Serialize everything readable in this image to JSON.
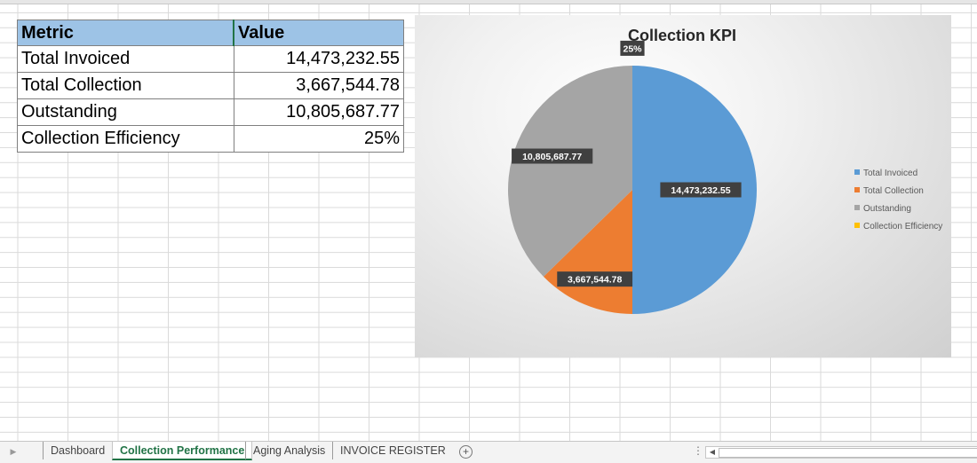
{
  "table": {
    "headers": [
      "Metric",
      "Value"
    ],
    "rows": [
      {
        "metric": "Total Invoiced",
        "value": "14,473,232.55"
      },
      {
        "metric": "Total Collection",
        "value": "3,667,544.78"
      },
      {
        "metric": "Outstanding",
        "value": "10,805,687.77"
      },
      {
        "metric": "Collection Efficiency",
        "value": "25%"
      }
    ]
  },
  "chart_data": {
    "type": "pie",
    "title": "Collection KPI",
    "categories": [
      "Total Invoiced",
      "Total Collection",
      "Outstanding",
      "Collection Efficiency"
    ],
    "values": [
      14473232.55,
      3667544.78,
      10805687.77,
      0.25
    ],
    "data_labels": [
      "14,473,232.55",
      "3,667,544.78",
      "10,805,687.77",
      "25%"
    ],
    "colors": [
      "#5b9bd5",
      "#ed7d31",
      "#a5a5a5",
      "#ffc000"
    ],
    "legend": "right"
  },
  "sheet_tabs": [
    {
      "label": "Dashboard",
      "active": false
    },
    {
      "label": "Collection Performance",
      "active": true
    },
    {
      "label": "Aging Analysis",
      "active": false
    },
    {
      "label": "INVOICE REGISTER",
      "active": false
    }
  ],
  "icons": {
    "add_sheet": "plus-circle-icon",
    "prev_sheet": "triangle-left-icon",
    "scroll_left": "triangle-left-icon"
  },
  "accent_color": "#217346",
  "header_fill": "#9dc3e6"
}
